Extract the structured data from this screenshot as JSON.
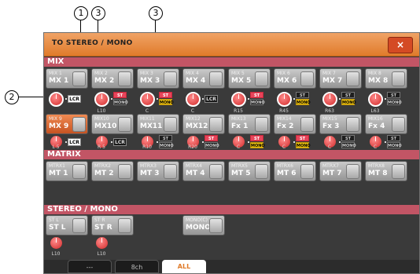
{
  "callouts": {
    "c1": "1",
    "c2": "2",
    "c3a": "3",
    "c3b": "3"
  },
  "title": "TO STEREO / MONO",
  "close_label": "×",
  "sections": {
    "mix": "MIX",
    "matrix": "MATRIX",
    "stereo_mono": "STEREO / MONO"
  },
  "mix_row1": [
    {
      "top": "MIX 1",
      "main": "MX 1"
    },
    {
      "top": "MIX 2",
      "main": "MX 2"
    },
    {
      "top": "MIX 3",
      "main": "MX 3"
    },
    {
      "top": "MIX 4",
      "main": "MX 4"
    },
    {
      "top": "MIX 5",
      "main": "MX 5"
    },
    {
      "top": "MIX 6",
      "main": "MX 6"
    },
    {
      "top": "MIX 7",
      "main": "MX 7"
    },
    {
      "top": "MIX 8",
      "main": "MX 8"
    }
  ],
  "mix_row1_knobs": [
    "",
    "L10",
    "C",
    "C",
    "R15",
    "R45",
    "R63",
    "L63"
  ],
  "mix_row2": [
    {
      "top": "MIX 9",
      "main": "MX 9"
    },
    {
      "top": "MIX10",
      "main": "MX10"
    },
    {
      "top": "MIX11",
      "main": "MX11"
    },
    {
      "top": "MIX12",
      "main": "MX12"
    },
    {
      "top": "MIX13",
      "main": "Fx 1"
    },
    {
      "top": "MIX14",
      "main": "Fx 2"
    },
    {
      "top": "MIX15",
      "main": "Fx 3"
    },
    {
      "top": "MIX16",
      "main": "Fx 4"
    }
  ],
  "mix_row2_knobs": [
    "L 5",
    "R 5",
    "R10",
    "R20",
    "C",
    "C",
    "C",
    "C"
  ],
  "matrix": [
    {
      "top": "MTRX1",
      "main": "MT 1"
    },
    {
      "top": "MTRX2",
      "main": "MT 2"
    },
    {
      "top": "MTRX3",
      "main": "MT 3"
    },
    {
      "top": "MTRX4",
      "main": "MT 4"
    },
    {
      "top": "MTRX5",
      "main": "MT 5"
    },
    {
      "top": "MTRX6",
      "main": "MT 6"
    },
    {
      "top": "MTRX7",
      "main": "MT 7"
    },
    {
      "top": "MTRX8",
      "main": "MT 8"
    }
  ],
  "stereo": [
    {
      "top": "ST L",
      "main": "ST L",
      "knob": "L10"
    },
    {
      "top": "ST R",
      "main": "ST R",
      "knob": "L10"
    },
    {
      "top": "MONO(C)",
      "main": "MONO"
    }
  ],
  "buttons": {
    "lcr": "LCR",
    "st": "ST",
    "mono": "MONO"
  },
  "tabs": [
    "---",
    "8ch",
    "ALL"
  ],
  "active_tab": "ALL",
  "colors": {
    "title_bar": "#e07b2a",
    "section_bar": "#c25565",
    "close_button": "#d44a24",
    "knob": "#d12a2a",
    "mono_on": "#f1c40f"
  }
}
